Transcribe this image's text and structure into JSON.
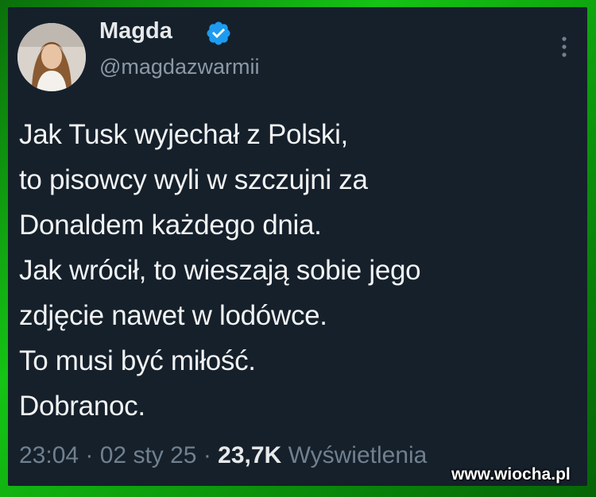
{
  "author": {
    "display_name": "Magda",
    "handle": "@magdazwarmii",
    "verified_icon": "verified-badge-icon",
    "verified_color": "#1d9bf0"
  },
  "more_icon": "more-options-icon",
  "tweet": {
    "lines": [
      "Jak Tusk wyjechał z Polski,",
      "to pisowcy wyli w szczujni za",
      "Donaldem każdego dnia.",
      "Jak wrócił, to wieszają sobie jego",
      "zdjęcie nawet w lodówce.",
      "To musi być miłość.",
      "Dobranoc."
    ]
  },
  "meta": {
    "time": "23:04",
    "separator": " · ",
    "date": "02 sty 25",
    "views_count": "23,7K",
    "views_label": "Wyświetlenia"
  },
  "watermark": "www.wiocha.pl",
  "colors": {
    "background": "#15202b",
    "frame_green": "#15c315",
    "text": "#e7e9ea",
    "muted": "#71808e"
  }
}
